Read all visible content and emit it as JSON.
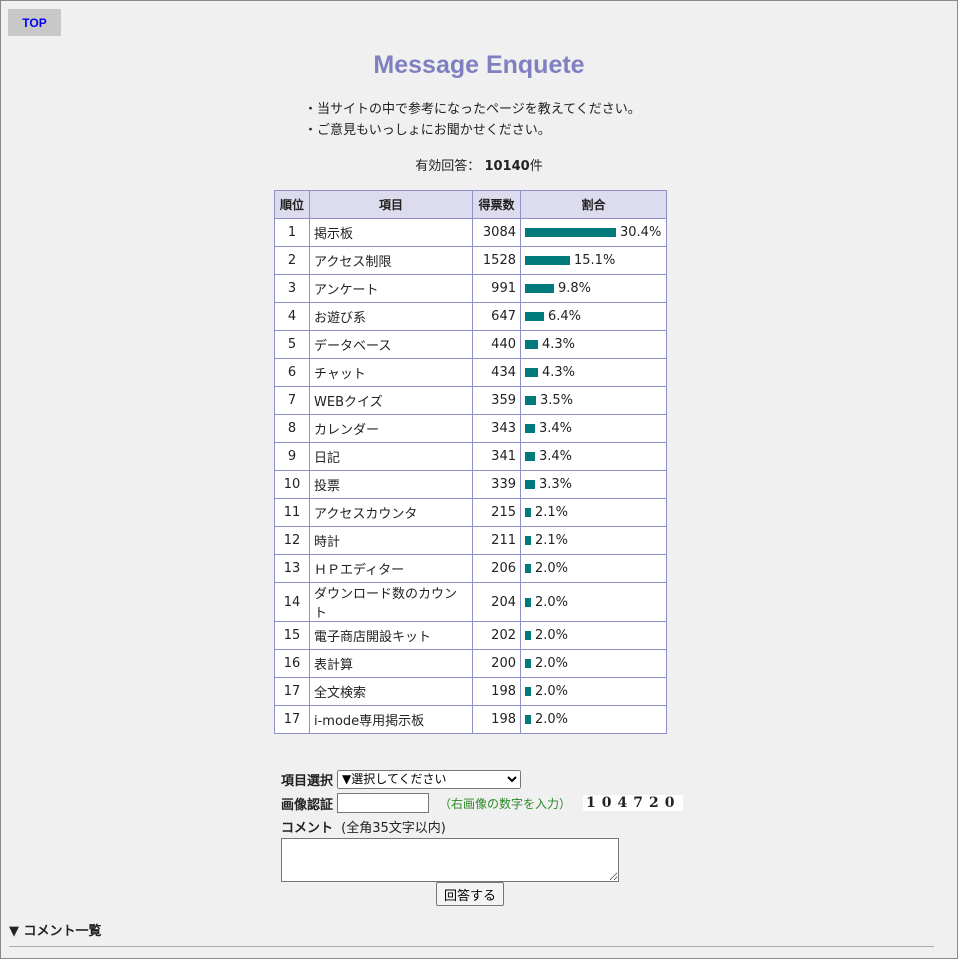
{
  "nav": {
    "top_label": "TOP"
  },
  "title": "Message Enquete",
  "intro": [
    "・当サイトの中で参考になったページを教えてください。",
    "・ご意見もいっしょにお聞かせください。"
  ],
  "total": {
    "label": "有効回答：",
    "count": "10140",
    "unit": "件"
  },
  "table": {
    "headers": [
      "順位",
      "項目",
      "得票数",
      "割合"
    ],
    "rows": [
      {
        "rank": "1",
        "item": "掲示板",
        "votes": "3084",
        "pct": "30.4%",
        "ratio": 30.4
      },
      {
        "rank": "2",
        "item": "アクセス制限",
        "votes": "1528",
        "pct": "15.1%",
        "ratio": 15.1
      },
      {
        "rank": "3",
        "item": "アンケート",
        "votes": "991",
        "pct": "9.8%",
        "ratio": 9.8
      },
      {
        "rank": "4",
        "item": "お遊び系",
        "votes": "647",
        "pct": "6.4%",
        "ratio": 6.4
      },
      {
        "rank": "5",
        "item": "データベース",
        "votes": "440",
        "pct": "4.3%",
        "ratio": 4.3
      },
      {
        "rank": "6",
        "item": "チャット",
        "votes": "434",
        "pct": "4.3%",
        "ratio": 4.3
      },
      {
        "rank": "7",
        "item": "WEBクイズ",
        "votes": "359",
        "pct": "3.5%",
        "ratio": 3.5
      },
      {
        "rank": "8",
        "item": "カレンダー",
        "votes": "343",
        "pct": "3.4%",
        "ratio": 3.4
      },
      {
        "rank": "9",
        "item": "日記",
        "votes": "341",
        "pct": "3.4%",
        "ratio": 3.4
      },
      {
        "rank": "10",
        "item": "投票",
        "votes": "339",
        "pct": "3.3%",
        "ratio": 3.3
      },
      {
        "rank": "11",
        "item": "アクセスカウンタ",
        "votes": "215",
        "pct": "2.1%",
        "ratio": 2.1
      },
      {
        "rank": "12",
        "item": "時計",
        "votes": "211",
        "pct": "2.1%",
        "ratio": 2.1
      },
      {
        "rank": "13",
        "item": "ＨＰエディター",
        "votes": "206",
        "pct": "2.0%",
        "ratio": 2.0
      },
      {
        "rank": "14",
        "item": "ダウンロード数のカウント",
        "votes": "204",
        "pct": "2.0%",
        "ratio": 2.0
      },
      {
        "rank": "15",
        "item": "電子商店開設キット",
        "votes": "202",
        "pct": "2.0%",
        "ratio": 2.0
      },
      {
        "rank": "16",
        "item": "表計算",
        "votes": "200",
        "pct": "2.0%",
        "ratio": 2.0
      },
      {
        "rank": "17",
        "item": "全文検索",
        "votes": "198",
        "pct": "2.0%",
        "ratio": 2.0
      },
      {
        "rank": "17",
        "item": "i-mode専用掲示板",
        "votes": "198",
        "pct": "2.0%",
        "ratio": 2.0
      }
    ],
    "bar_color": "#007a7a"
  },
  "form": {
    "select_label": "項目選択",
    "select_value": "▼選択してください",
    "captcha_label": "画像認証",
    "captcha_hint": "（右画像の数字を入力）",
    "captcha_code": "104720",
    "comment_label": "コメント",
    "comment_note": "(全角35文字以内)",
    "submit_label": "回答する"
  },
  "comments_heading": "▼ コメント一覧"
}
